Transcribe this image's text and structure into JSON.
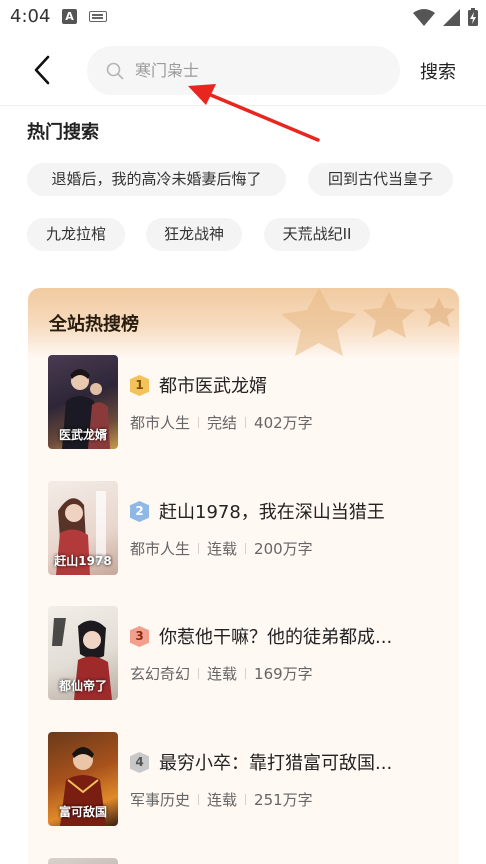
{
  "status_bar": {
    "time": "4:04",
    "notification_icon_letter": "A",
    "icons": [
      "font-notification-icon",
      "keyboard-icon",
      "wifi-icon",
      "signal-icon",
      "battery-charging-icon"
    ]
  },
  "header": {
    "back_icon": "chevron-left-icon",
    "search_icon": "search-icon",
    "search_placeholder": "寒门枭士",
    "search_button": "搜索"
  },
  "hot_search": {
    "title": "热门搜索",
    "tags": [
      "退婚后，我的高冷未婚妻后悔了",
      "回到古代当皇子",
      "九龙拉棺",
      "狂龙战神",
      "天荒战纪II"
    ]
  },
  "ranking": {
    "title": "全站热搜榜",
    "books": [
      {
        "rank": "1",
        "title": "都市医武龙婿",
        "category": "都市人生",
        "status": "完结",
        "words": "402万字",
        "cover_text": "医武龙婿"
      },
      {
        "rank": "2",
        "title": "赶山1978，我在深山当猎王",
        "category": "都市人生",
        "status": "连载",
        "words": "200万字",
        "cover_text": "赶山1978"
      },
      {
        "rank": "3",
        "title": "你惹他干嘛？他的徒弟都成...",
        "category": "玄幻奇幻",
        "status": "连载",
        "words": "169万字",
        "cover_text": "都仙帝了"
      },
      {
        "rank": "4",
        "title": "最穷小卒：靠打猎富可敌国...",
        "category": "军事历史",
        "status": "连载",
        "words": "251万字",
        "cover_text": "富可敌国"
      }
    ]
  },
  "colors": {
    "rank1": "#f3c35a",
    "rank2": "#8fb8e6",
    "rank3": "#f2a08d",
    "rank4": "#c8c8c8",
    "arrow": "#e8261f"
  }
}
